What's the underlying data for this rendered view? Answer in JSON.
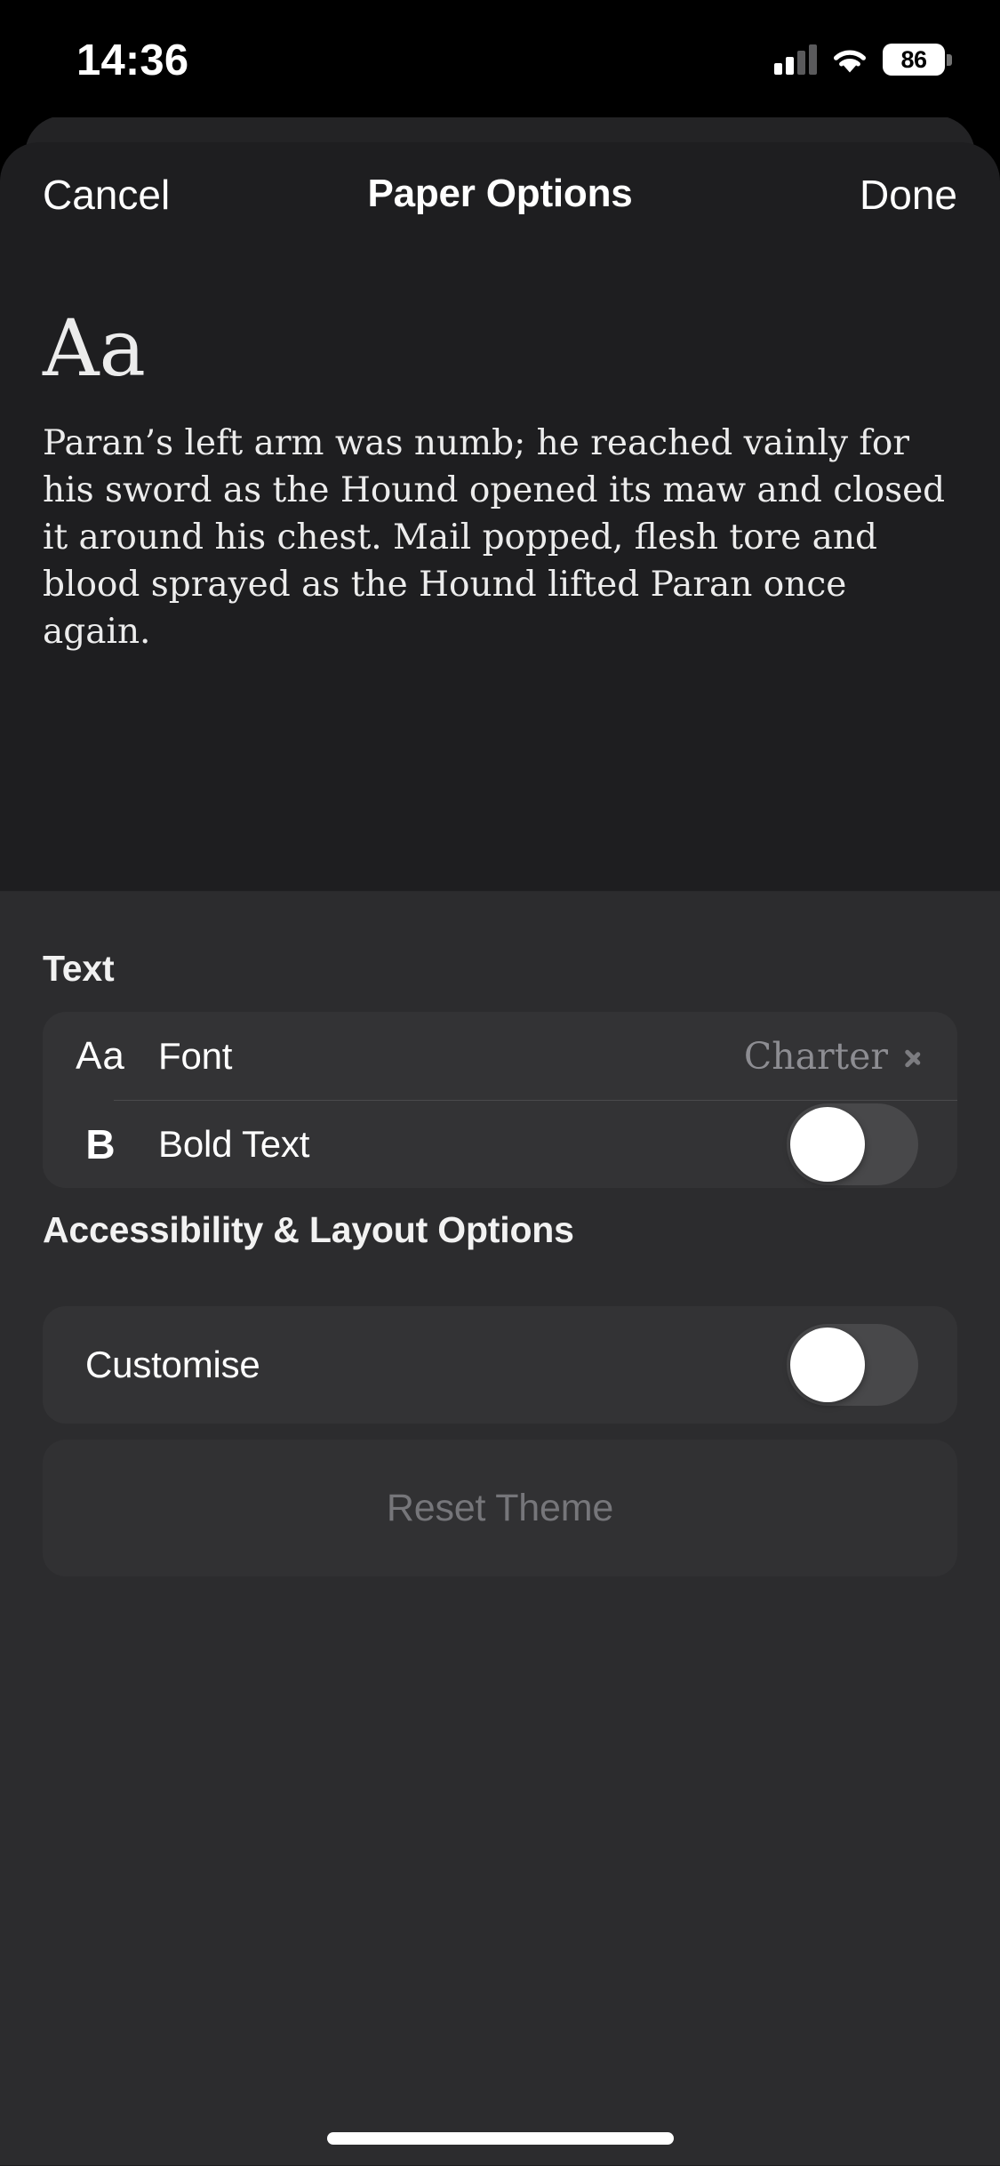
{
  "status_bar": {
    "time": "14:36",
    "battery_level": "86",
    "cellular_icon": "cellular-bars-icon",
    "wifi_icon": "wifi-icon",
    "battery_icon": "battery-icon"
  },
  "nav": {
    "cancel_label": "Cancel",
    "title": "Paper Options",
    "done_label": "Done"
  },
  "preview": {
    "sample_glyphs": "Aa",
    "sample_paragraph": "Paran’s left arm was numb; he reached vainly for his sword as the Hound opened its maw and closed it around his chest. Mail popped, flesh tore and blood sprayed as the Hound lifted Paran once again."
  },
  "sections": {
    "text": {
      "header": "Text",
      "rows": [
        {
          "icon_label": "Aa",
          "icon_name": "font-aa-icon",
          "label": "Font",
          "value": "Charter",
          "accessory": "chevron-right-icon"
        },
        {
          "icon_label": "B",
          "icon_name": "bold-b-icon",
          "label": "Bold Text",
          "toggle_state": "off"
        }
      ]
    },
    "accessibility": {
      "header": "Accessibility & Layout Options",
      "rows": [
        {
          "label": "Customise",
          "toggle_state": "off"
        }
      ],
      "reset_button": {
        "label": "Reset Theme",
        "enabled": "false"
      }
    }
  },
  "colors": {
    "sheet_background": "#1e1e20",
    "settings_background": "#2c2c2e",
    "card_background": "#333335",
    "toggle_off_track": "#48484a",
    "secondary_text": "#8d8d92",
    "disabled_text": "#76767a",
    "primary_text": "#ffffff"
  },
  "home_indicator": "home-indicator"
}
